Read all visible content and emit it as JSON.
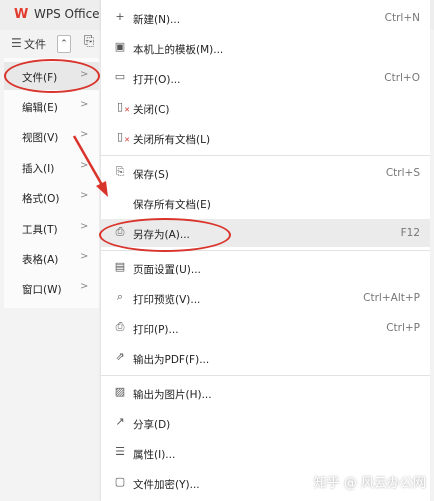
{
  "app": {
    "title": "WPS Office"
  },
  "toolbar": {
    "menu_icon": "☰",
    "file_label": "文件",
    "caret": "⌃",
    "save_icon": "⎘"
  },
  "left_menu": {
    "items": [
      {
        "label": "文件(F)",
        "arrow": ">"
      },
      {
        "label": "编辑(E)",
        "arrow": ">"
      },
      {
        "label": "视图(V)",
        "arrow": ">"
      },
      {
        "label": "插入(I)",
        "arrow": ">"
      },
      {
        "label": "格式(O)",
        "arrow": ">"
      },
      {
        "label": "工具(T)",
        "arrow": ">"
      },
      {
        "label": "表格(A)",
        "arrow": ">"
      },
      {
        "label": "窗口(W)",
        "arrow": ">"
      }
    ]
  },
  "dropdown": {
    "items": [
      {
        "icon": "+",
        "label": "新建(N)...",
        "shortcut": "Ctrl+N"
      },
      {
        "icon": "▣",
        "label": "本机上的模板(M)...",
        "shortcut": ""
      },
      {
        "icon": "▭",
        "label": "打开(O)...",
        "shortcut": "Ctrl+O"
      },
      {
        "icon": "▯",
        "label": "关闭(C)",
        "shortcut": ""
      },
      {
        "icon": "▯",
        "label": "关闭所有文档(L)",
        "shortcut": ""
      },
      {
        "icon": "⎘",
        "label": "保存(S)",
        "shortcut": "Ctrl+S"
      },
      {
        "icon": "",
        "label": "保存所有文档(E)",
        "shortcut": ""
      },
      {
        "icon": "⎙",
        "label": "另存为(A)...",
        "shortcut": "F12"
      },
      {
        "icon": "▤",
        "label": "页面设置(U)...",
        "shortcut": ""
      },
      {
        "icon": "⌕",
        "label": "打印预览(V)...",
        "shortcut": "Ctrl+Alt+P"
      },
      {
        "icon": "⎙",
        "label": "打印(P)...",
        "shortcut": "Ctrl+P"
      },
      {
        "icon": "⇗",
        "label": "输出为PDF(F)...",
        "shortcut": ""
      },
      {
        "icon": "▨",
        "label": "输出为图片(H)...",
        "shortcut": ""
      },
      {
        "icon": "↗",
        "label": "分享(D)",
        "shortcut": ""
      },
      {
        "icon": "☰",
        "label": "属性(I)...",
        "shortcut": ""
      },
      {
        "icon": "▢",
        "label": "文件加密(Y)...",
        "shortcut": ""
      }
    ]
  },
  "watermark": "知乎 @ 风云办公网",
  "colors": {
    "annotation": "#d9342b",
    "logo": "#e23b2e"
  }
}
